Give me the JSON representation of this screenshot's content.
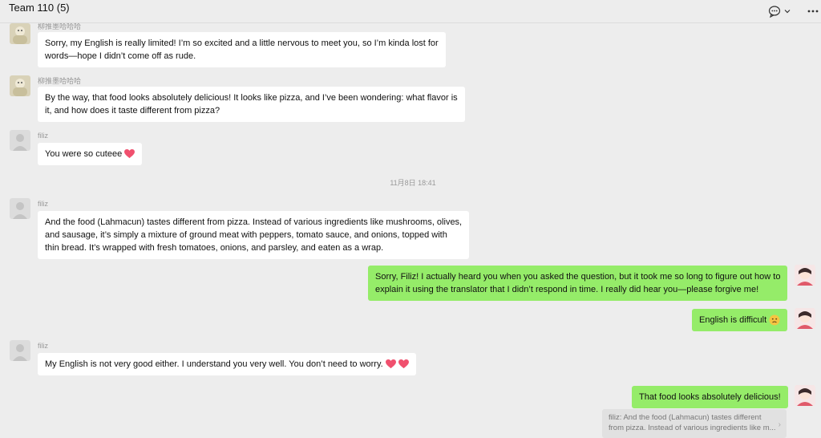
{
  "header": {
    "title": "Team 110 (5)"
  },
  "messages": {
    "m1": {
      "nickname": "柳推墨哈哈哈",
      "line1": "Sorry, my English is really limited! I’m so excited and a little nervous to meet you, so I’m kinda lost for",
      "line2": "words—hope I didn’t come off as rude."
    },
    "m2": {
      "nickname": "柳推墨哈哈哈",
      "line1": "By the way, that food looks absolutely delicious! It looks like pizza, and I’ve been wondering: what flavor is",
      "line2": "it, and how does it taste different from pizza?"
    },
    "m3": {
      "nickname": "filiz",
      "text": "You were so cuteee"
    },
    "timestamp": "11月8日 18:41",
    "m4": {
      "nickname": "filiz",
      "line1": "And the food (Lahmacun) tastes different from pizza. Instead of various ingredients like mushrooms, olives,",
      "line2": "and sausage, it’s simply a mixture of ground meat with peppers, tomato sauce, and onions, topped with",
      "line3": "thin bread. It’s wrapped with fresh tomatoes, onions, and parsley, and eaten as a wrap."
    },
    "m5": {
      "line1": "Sorry, Filiz! I actually heard you when you asked the question, but it took me so long to figure out how to",
      "line2": "explain it using the translator that I didn’t respond in time. I really did hear you—please forgive me!"
    },
    "m6": {
      "text": "English is difficult"
    },
    "m7": {
      "nickname": "filiz",
      "text": "My English is not very good either. I understand you very well. You don’t need to worry."
    },
    "m8": {
      "text": "That food looks absolutely delicious!"
    },
    "quote": {
      "line1": "filiz: And the food (Lahmacun) tastes different",
      "line2": "from pizza. Instead of various ingredients like m..."
    }
  },
  "colors": {
    "background": "#ededed",
    "incoming_bubble": "#ffffff",
    "outgoing_bubble": "#95ec69",
    "heart": "#f0506e"
  },
  "icons": {
    "chat_menu": "chat-bubble-icon",
    "more": "more-dots-icon",
    "heart": "heart-icon",
    "emoji": "emoji-face-icon"
  }
}
